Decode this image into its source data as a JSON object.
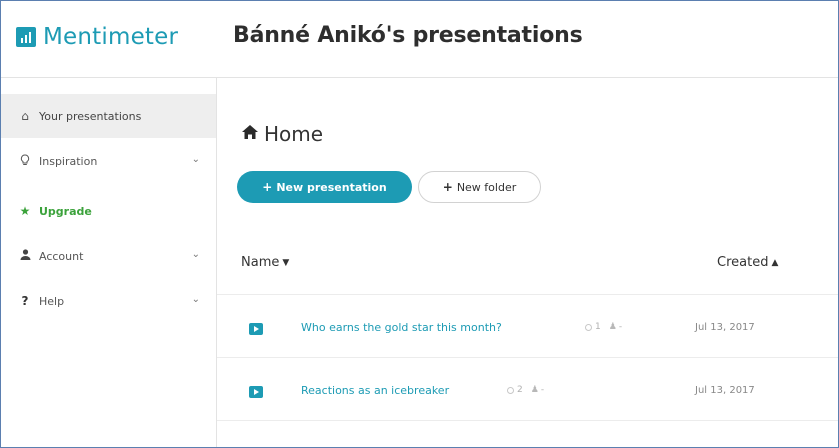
{
  "app": {
    "logo_text": "Mentimeter",
    "page_heading": "Bánné Anikó's presentations",
    "brand_color": "#1d9bb4"
  },
  "sidebar": {
    "items": [
      {
        "label": "Your presentations",
        "icon": "home-icon",
        "active": true
      },
      {
        "label": "Inspiration",
        "icon": "lightbulb-icon",
        "expandable": true
      },
      {
        "label": "Upgrade",
        "icon": "star-icon",
        "color": "#3ba23b"
      },
      {
        "label": "Account",
        "icon": "user-icon",
        "expandable": true
      },
      {
        "label": "Help",
        "icon": "question-icon",
        "expandable": true
      }
    ]
  },
  "main": {
    "breadcrumb": "Home",
    "new_presentation_label": "New presentation",
    "new_folder_label": "New folder",
    "columns": {
      "name": "Name",
      "created": "Created"
    },
    "rows": [
      {
        "title": "Who earns the gold star this month?",
        "count": "1",
        "owner": "-",
        "created": "Jul 13, 2017"
      },
      {
        "title": "Reactions as an icebreaker",
        "count": "2",
        "owner": "-",
        "created": "Jul 13, 2017"
      }
    ]
  }
}
